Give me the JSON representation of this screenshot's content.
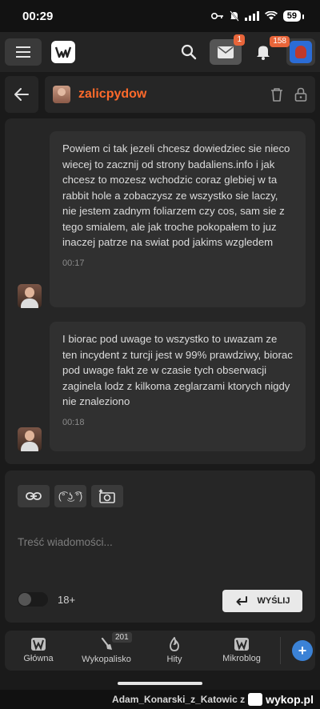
{
  "status_bar": {
    "time": "00:29",
    "battery": "59"
  },
  "nav": {
    "mail_badge": "1",
    "bell_badge": "158"
  },
  "conversation": {
    "username": "zalicpydow"
  },
  "messages": [
    {
      "text": "Powiem ci tak jezeli chcesz dowiedziec sie nieco wiecej to zacznij od strony badaliens.info i jak chcesz to mozesz wchodzic coraz glebiej w ta rabbit hole a zobaczysz ze wszystko sie laczy, nie jestem zadnym foliarzem czy cos, sam sie z tego smialem, ale jak troche pokopałem to juz inaczej patrze na swiat pod jakims wzgledem",
      "time": "00:17"
    },
    {
      "text": "I biorac pod uwage to wszystko to uwazam ze ten incydent z turcji jest w 99% prawdziwy, biorac pod uwage fakt ze w czasie tych obserwacji zaginela lodz z kilkoma zeglarzami ktorych nigdy nie znaleziono",
      "time": "00:18"
    }
  ],
  "composer": {
    "lenny_label": "(͡° ͜ʖ ͡°)",
    "placeholder": "Treść wiadomości...",
    "adult_label": "18+",
    "send_label": "WYŚLIJ"
  },
  "bottom_nav": {
    "items": [
      {
        "label": "Główna"
      },
      {
        "label": "Wykopalisko",
        "badge": "201"
      },
      {
        "label": "Hity"
      },
      {
        "label": "Mikroblog"
      }
    ],
    "plus": "+"
  },
  "watermark": {
    "user": "Adam_Konarski_z_Katowic z",
    "site": "wykop.pl"
  }
}
